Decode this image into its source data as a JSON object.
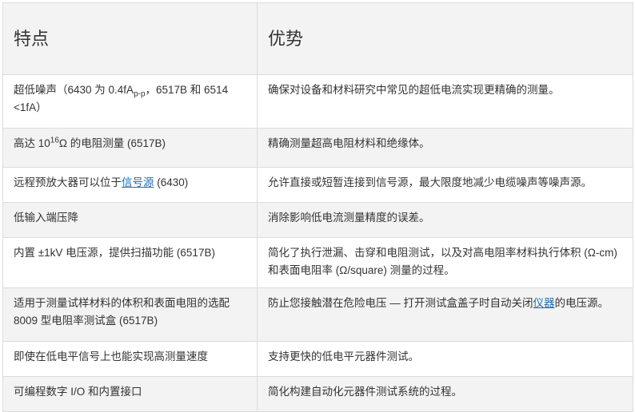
{
  "table": {
    "headers": [
      "特点",
      "优势"
    ],
    "rows": [
      {
        "feature_prefix": "超低噪声（6430 为 0.4fA",
        "feature_sub": "p-p",
        "feature_suffix": "，6517B 和 6514 <1fA）",
        "benefit": "确保对设备和材料研究中常见的超低电流实现更精确的测量。"
      },
      {
        "feature_prefix": "高达 10",
        "feature_sup": "16",
        "feature_suffix": "Ω 的电阻测量 (6517B)",
        "benefit": "精确测量超高电阻材料和绝缘体。"
      },
      {
        "feature_prefix": "远程预放大器可以位于",
        "feature_link": "信号源",
        "feature_suffix": " (6430)",
        "benefit": "允许直接或短暂连接到信号源，最大限度地减少电缆噪声等噪声源。"
      },
      {
        "feature": "低输入端压降",
        "benefit": "消除影响低电流测量精度的误差。"
      },
      {
        "feature": "内置 ±1kV 电压源，提供扫描功能 (6517B)",
        "benefit": "简化了执行泄漏、击穿和电阻测试，以及对高电阻率材料执行体积 (Ω-cm) 和表面电阻率 (Ω/square) 测量的过程。"
      },
      {
        "feature": "适用于测量试样材料的体积和表面电阻的选配 8009 型电阻率测试盒 (6517B)",
        "benefit_prefix": "防止您接触潜在危险电压 — 打开测试盒盖子时自动关闭",
        "benefit_link": "仪器",
        "benefit_suffix": "的电压源。"
      },
      {
        "feature": "即使在低电平信号上也能实现高测量速度",
        "benefit": "支持更快的低电平元器件测试。"
      },
      {
        "feature": "可编程数字 I/O 和内置接口",
        "benefit": "简化构建自动化元器件测试系统的过程。"
      }
    ]
  },
  "colors": {
    "link": "#1f6fb2",
    "border": "#dcdcdc",
    "stripe": "#f3f3f3",
    "text": "#333333"
  }
}
